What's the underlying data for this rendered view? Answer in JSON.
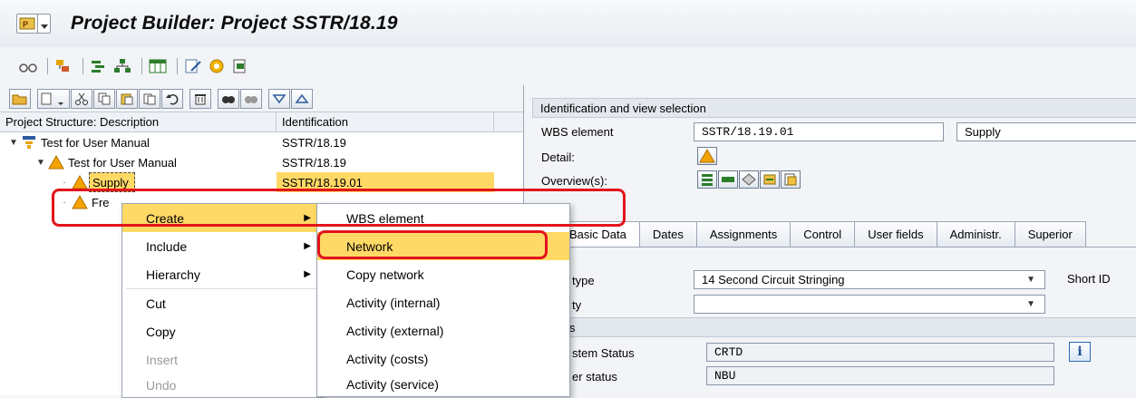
{
  "window": {
    "title": "Project Builder: Project SSTR/18.19"
  },
  "tree": {
    "headers": [
      "Project Structure: Description",
      "Identification"
    ],
    "rows": [
      {
        "desc": "Test for User Manual",
        "id": "SSTR/18.19"
      },
      {
        "desc": "Test for User Manual",
        "id": "SSTR/18.19"
      },
      {
        "desc": "Supply",
        "id": "SSTR/18.19.01"
      },
      {
        "desc": "Fre",
        "id": ""
      }
    ]
  },
  "right": {
    "section_title": "Identification and view selection",
    "wbs_label": "WBS element",
    "wbs_value": "SSTR/18.19.01",
    "wbs_desc": "Supply",
    "detail_label": "Detail:",
    "overview_label": "Overview(s):",
    "tabs": [
      "Basic Data",
      "Dates",
      "Assignments",
      "Control",
      "User fields",
      "Administr.",
      "Superior"
    ],
    "type_label": "type",
    "type_value": "14 Second Circuit Stringing",
    "short_id_label": "Short ID",
    "priority_label": "ty",
    "status_section": "tus",
    "system_status_label": "stem Status",
    "system_status_value": "CRTD",
    "user_status_label": "er status",
    "user_status_value": "NBU"
  },
  "context_menu": {
    "items": [
      {
        "label": "Create",
        "underline": "",
        "submenu": true,
        "highlight": true,
        "disabled": false
      },
      {
        "label": "Include",
        "submenu": true,
        "disabled": false
      },
      {
        "label": "Hierarchy",
        "submenu": true,
        "disabled": false
      },
      {
        "label": "Cut",
        "submenu": false,
        "disabled": false
      },
      {
        "label": "Copy",
        "submenu": false,
        "disabled": false
      },
      {
        "label": "Insert",
        "submenu": false,
        "disabled": true
      },
      {
        "label": "Undo",
        "submenu": false,
        "disabled": true
      }
    ]
  },
  "submenu": {
    "items": [
      "WBS element",
      "Network",
      "Copy network",
      "Activity (internal)",
      "Activity (external)",
      "Activity (costs)",
      "Activity (service)"
    ],
    "highlighted": "Network"
  },
  "colors": {
    "selection": "#ffd966",
    "annotation": "#e3141b",
    "warning": "#f5a300"
  }
}
